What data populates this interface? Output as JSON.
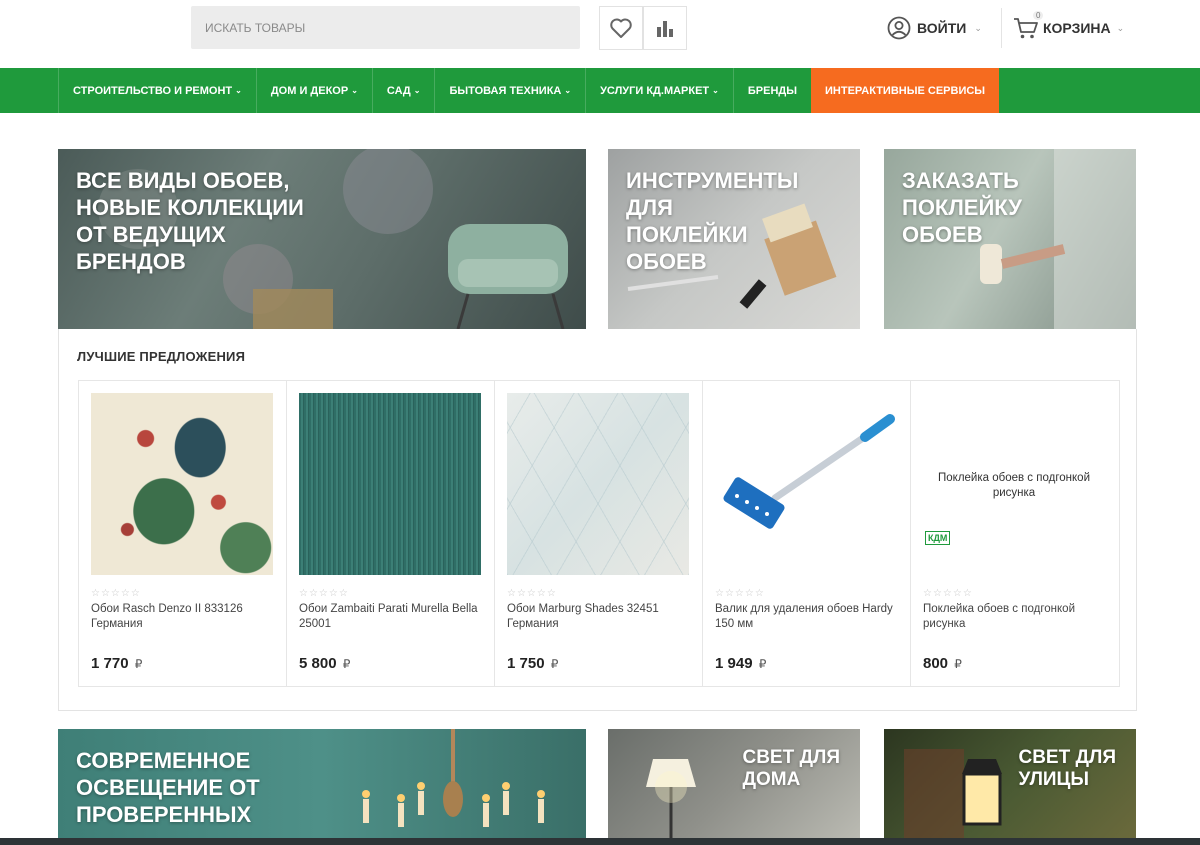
{
  "header": {
    "search_placeholder": "ИСКАТЬ ТОВАРЫ",
    "login_label": "ВОЙТИ",
    "cart_label": "КОРЗИНА",
    "cart_count": "0"
  },
  "nav": {
    "items": [
      {
        "label": "СТРОИТЕЛЬСТВО И РЕМОНТ",
        "has_dropdown": true
      },
      {
        "label": "ДОМ И ДЕКОР",
        "has_dropdown": true
      },
      {
        "label": "САД",
        "has_dropdown": true
      },
      {
        "label": "БЫТОВАЯ ТЕХНИКА",
        "has_dropdown": true
      },
      {
        "label": "УСЛУГИ КД.МАРКЕТ",
        "has_dropdown": true
      },
      {
        "label": "БРЕНДЫ",
        "has_dropdown": false
      },
      {
        "label": "ИНТЕРАКТИВНЫЕ СЕРВИСЫ",
        "has_dropdown": false
      }
    ],
    "accent_color": "#f66b1f",
    "bar_color": "#1f9a3c"
  },
  "banners": {
    "wallpaper": "ВСЕ ВИДЫ ОБОЕВ,\nНОВЫЕ КОЛЛЕКЦИИ\nОТ ВЕДУЩИХ\nБРЕНДОВ",
    "tools": "ИНСТРУМЕНТЫ\nДЛЯ\nПОКЛЕЙКИ\nОБОЕВ",
    "order": "ЗАКАЗАТЬ\nПОКЛЕЙКУ\nОБОЕВ",
    "lighting": "СОВРЕМЕННОЕ\nОСВЕЩЕНИЕ ОТ\nПРОВЕРЕННЫХ",
    "home_light": "СВЕТ ДЛЯ\nДОМА",
    "street_light": "СВЕТ ДЛЯ\nУЛИЦЫ"
  },
  "offers": {
    "title": "ЛУЧШИЕ ПРЕДЛОЖЕНИЯ",
    "currency": "₽",
    "products": [
      {
        "name": "Обои Rasch Denzo II 833126 Германия",
        "price": "1 770",
        "rating": 0,
        "image": "tropical-wallpaper"
      },
      {
        "name": "Обои Zambaiti Parati Murella Bella 25001",
        "price": "5 800",
        "rating": 0,
        "image": "green-textured-wallpaper"
      },
      {
        "name": "Обои Marburg Shades 32451 Германия",
        "price": "1 750",
        "rating": 0,
        "image": "diamond-pattern-wallpaper"
      },
      {
        "name": "Валик для удаления обоев Hardy 150 мм",
        "price": "1 949",
        "rating": 0,
        "image": "perforating-roller"
      },
      {
        "name": "Поклейка обоев с подгонкой рисунка",
        "price": "800",
        "rating": 0,
        "image": "service-card",
        "image_text": "Поклейка обоев с подгонкой рисунка",
        "logo_text": "КДМ"
      }
    ]
  }
}
